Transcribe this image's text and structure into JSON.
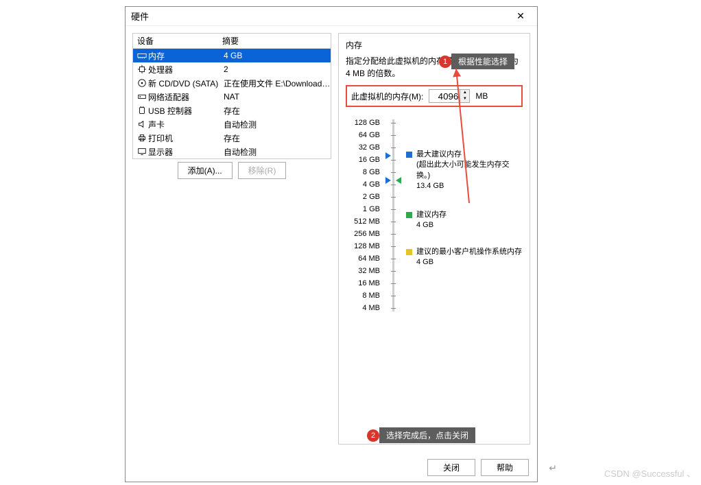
{
  "dialog": {
    "title": "硬件",
    "close_x": "✕"
  },
  "device_table": {
    "header_device": "设备",
    "header_summary": "摘要",
    "rows": [
      {
        "icon": "memory-icon",
        "name": "内存",
        "summary": "4 GB",
        "selected": true
      },
      {
        "icon": "cpu-icon",
        "name": "处理器",
        "summary": "2",
        "selected": false
      },
      {
        "icon": "disc-icon",
        "name": "新 CD/DVD (SATA)",
        "summary": "正在使用文件 E:\\Download\\...",
        "selected": false
      },
      {
        "icon": "network-icon",
        "name": "网络适配器",
        "summary": "NAT",
        "selected": false
      },
      {
        "icon": "usb-icon",
        "name": "USB 控制器",
        "summary": "存在",
        "selected": false
      },
      {
        "icon": "sound-icon",
        "name": "声卡",
        "summary": "自动检测",
        "selected": false
      },
      {
        "icon": "printer-icon",
        "name": "打印机",
        "summary": "存在",
        "selected": false
      },
      {
        "icon": "display-icon",
        "name": "显示器",
        "summary": "自动检测",
        "selected": false
      }
    ]
  },
  "left_buttons": {
    "add": "添加(A)...",
    "remove": "移除(R)"
  },
  "memory_panel": {
    "title": "内存",
    "desc": "指定分配给此虚拟机的内存量。内存大小必须为 4 MB 的倍数。",
    "input_label": "此虚拟机的内存(M):",
    "input_value": "4096",
    "unit": "MB",
    "scale_labels": [
      "128 GB",
      "64 GB",
      "32 GB",
      "16 GB",
      "8 GB",
      "4 GB",
      "2 GB",
      "1 GB",
      "512 MB",
      "256 MB",
      "128 MB",
      "64 MB",
      "32 MB",
      "16 MB",
      "8 MB",
      "4 MB"
    ],
    "max_rec_title": "最大建议内存",
    "max_rec_note": "(超出此大小可能发生内存交换。)",
    "max_rec_value": "13.4 GB",
    "rec_title": "建议内存",
    "rec_value": "4 GB",
    "min_rec_title": "建议的最小客户机操作系统内存",
    "min_rec_value": "4 GB"
  },
  "annotations": {
    "a1_num": "1",
    "a1_text": "根据性能选择",
    "a2_num": "2",
    "a2_text": "选择完成后，点击关闭"
  },
  "footer": {
    "close": "关闭",
    "help": "帮助"
  },
  "watermark": "CSDN @Successful  、",
  "pilcrow": "↵"
}
